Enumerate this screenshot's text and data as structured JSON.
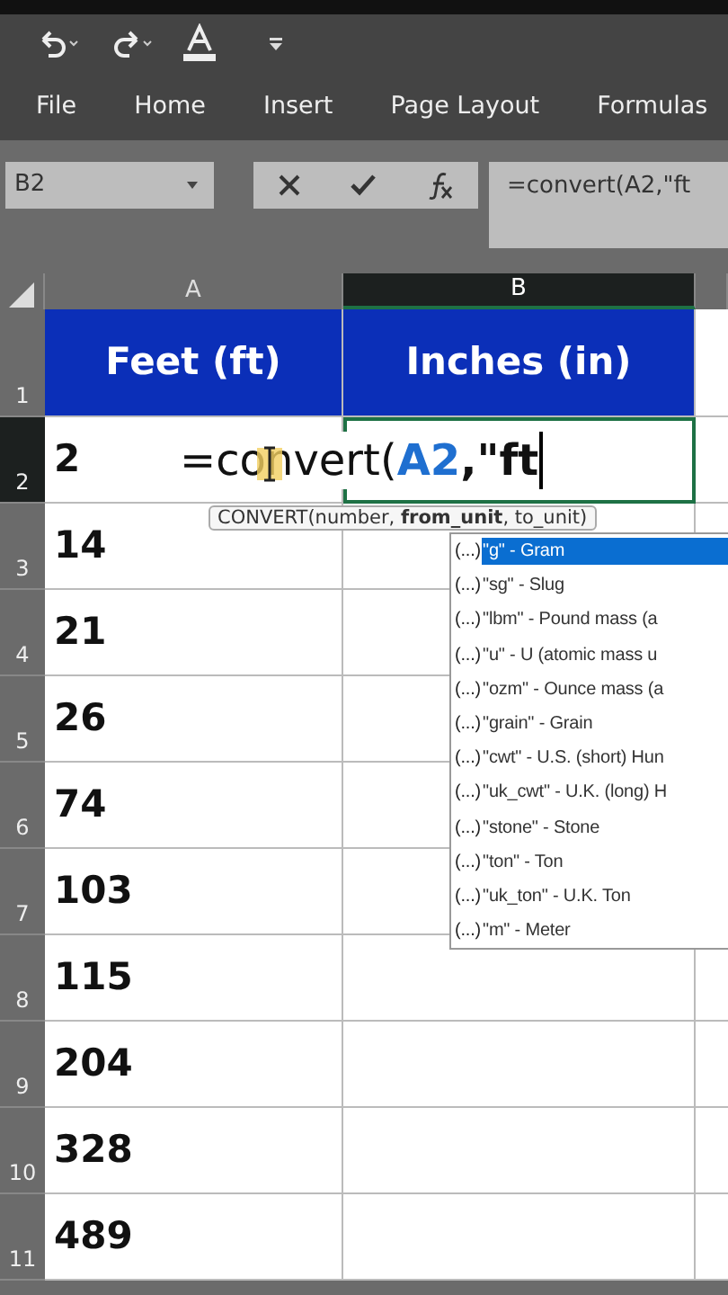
{
  "quick_access": {
    "buttons": [
      {
        "kind": "undo"
      },
      {
        "kind": "redo"
      },
      {
        "kind": "font-color"
      },
      {
        "kind": "customize"
      }
    ]
  },
  "ribbon_tabs": [
    {
      "label": "File",
      "selected": false
    },
    {
      "label": "Home",
      "selected": false
    },
    {
      "label": "Insert",
      "selected": false
    },
    {
      "label": "Page Layout",
      "selected": false
    },
    {
      "label": "Formulas",
      "selected": false
    }
  ],
  "formula_bar": {
    "name_box": "B2",
    "formula": "=convert(A2,\"ft"
  },
  "columns": [
    {
      "label": "A",
      "selected": false
    },
    {
      "label": "B",
      "selected": true
    }
  ],
  "rows": [
    {
      "number": "1",
      "cells": [
        "Feet (ft)",
        "Inches (in)"
      ],
      "kind": "header"
    },
    {
      "number": "2",
      "cells": [
        "2",
        ""
      ],
      "kind": "data",
      "selected": true
    },
    {
      "number": "3",
      "cells": [
        "14",
        ""
      ],
      "kind": "data",
      "selected": false
    },
    {
      "number": "4",
      "cells": [
        "21",
        ""
      ],
      "kind": "data",
      "selected": false
    },
    {
      "number": "5",
      "cells": [
        "26",
        ""
      ],
      "kind": "data",
      "selected": false
    },
    {
      "number": "6",
      "cells": [
        "74",
        ""
      ],
      "kind": "data",
      "selected": false
    },
    {
      "number": "7",
      "cells": [
        "103",
        ""
      ],
      "kind": "data",
      "selected": false
    },
    {
      "number": "8",
      "cells": [
        "115",
        ""
      ],
      "kind": "data",
      "selected": false
    },
    {
      "number": "9",
      "cells": [
        "204",
        ""
      ],
      "kind": "data",
      "selected": false
    },
    {
      "number": "10",
      "cells": [
        "328",
        ""
      ],
      "kind": "data",
      "selected": false
    },
    {
      "number": "11",
      "cells": [
        "489",
        ""
      ],
      "kind": "data",
      "selected": false
    }
  ],
  "cell_editor": {
    "prefix": "=convert(",
    "reference": "A2",
    "suffix": ",\"ft"
  },
  "tooltip": "CONVERT(number, **from_unit**, to_unit)",
  "autocomplete": [
    {
      "icon_text": "(...)",
      "label": "\"g\" - Gram",
      "selected": true
    },
    {
      "icon_text": "(...)",
      "label": "\"sg\" - Slug",
      "selected": false
    },
    {
      "icon_text": "(...)",
      "label": "\"lbm\" - Pound mass (a",
      "selected": false
    },
    {
      "icon_text": "(...)",
      "label": "\"u\" - U (atomic mass u",
      "selected": false
    },
    {
      "icon_text": "(...)",
      "label": "\"ozm\" - Ounce mass (a",
      "selected": false
    },
    {
      "icon_text": "(...)",
      "label": "\"grain\" - Grain",
      "selected": false
    },
    {
      "icon_text": "(...)",
      "label": "\"cwt\" - U.S. (short) Hun",
      "selected": false
    },
    {
      "icon_text": "(...)",
      "label": "\"uk_cwt\" - U.K. (long) H",
      "selected": false
    },
    {
      "icon_text": "(...)",
      "label": "\"stone\" - Stone",
      "selected": false
    },
    {
      "icon_text": "(...)",
      "label": "\"ton\" - Ton",
      "selected": false
    },
    {
      "icon_text": "(...)",
      "label": "\"uk_ton\" - U.K. Ton",
      "selected": false
    },
    {
      "icon_text": "(...)",
      "label": "\"m\" - Meter",
      "selected": false
    }
  ]
}
